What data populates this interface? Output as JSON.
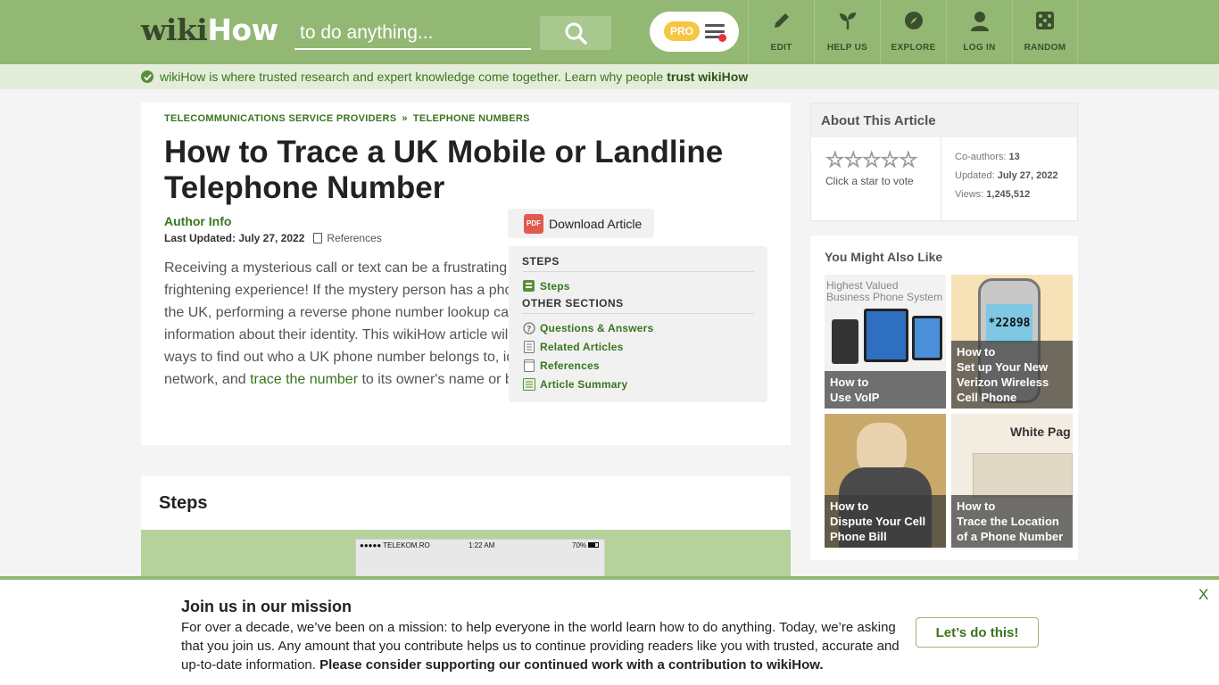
{
  "header": {
    "logo_wiki": "wiki",
    "logo_how": "How",
    "search_placeholder": "to do anything...",
    "pro_label": "PRO",
    "nav": [
      {
        "label": "EDIT",
        "icon": "pencil-icon"
      },
      {
        "label": "HELP US",
        "icon": "sprout-icon"
      },
      {
        "label": "EXPLORE",
        "icon": "compass-icon"
      },
      {
        "label": "LOG IN",
        "icon": "user-icon"
      },
      {
        "label": "RANDOM",
        "icon": "dice-icon"
      }
    ]
  },
  "trust": {
    "text": "wikiHow is where trusted research and expert knowledge come together. Learn why people",
    "link": "trust wikiHow"
  },
  "article": {
    "crumb1": "TELECOMMUNICATIONS SERVICE PROVIDERS",
    "crumb_sep": "»",
    "crumb2": "TELEPHONE NUMBERS",
    "title": "How to Trace a UK Mobile or Landline Telephone Number",
    "author_info": "Author Info",
    "last_updated": "Last Updated: July 27, 2022",
    "references": "References",
    "intro_before": "Receiving a mysterious call or text can be a frustrating or even frightening experience! If the mystery person has a phone number from the UK, performing a reverse phone number lookup can give you lots of information about their identity. This wikiHow article will show you simple ways to find out who a UK phone number belongs to, identify its mobile network, and ",
    "intro_link": "trace the number",
    "intro_after": " to its owner's name or business.",
    "download_label": "Download Article",
    "pdf_label": "PDF",
    "toc": {
      "steps_head": "STEPS",
      "steps_item": "Steps",
      "other_head": "OTHER SECTIONS",
      "items": [
        "Questions & Answers",
        "Related Articles",
        "References",
        "Article Summary"
      ]
    }
  },
  "steps": {
    "title": "Steps",
    "phone_carrier": "●●●●● TELEKOM.RO",
    "phone_time": "1:22 AM",
    "phone_battery": "70%"
  },
  "about": {
    "title": "About This Article",
    "vote": "Click a star to vote",
    "coauthors_label": "Co-authors:",
    "coauthors": "13",
    "updated_label": "Updated:",
    "updated": "July 27, 2022",
    "views_label": "Views:",
    "views": "1,245,512"
  },
  "also": {
    "title": "You Might Also Like",
    "tiles": [
      {
        "line1": "How to",
        "line2": "Use VoIP",
        "image_text": "Highest Valued Business Phone System"
      },
      {
        "line1": "How to",
        "line2": "Set up Your New Verizon Wireless Cell Phone",
        "image_text": "*22898"
      },
      {
        "line1": "How to",
        "line2": "Dispute Your Cell Phone Bill",
        "image_text": ""
      },
      {
        "line1": "How to",
        "line2": "Trace the Location of a Phone Number",
        "image_text": "White Pag"
      }
    ]
  },
  "mission": {
    "title": "Join us in our mission",
    "body": "For over a decade, we’ve been on a mission: to help everyone in the world learn how to do anything. Today, we’re asking that you join us. Any amount that you contribute helps us to continue providing readers like you with trusted, accurate and up-to-date information. ",
    "body_bold": "Please consider supporting our continued work with a contribution to wikiHow.",
    "button": "Let’s do this!",
    "close": "X"
  },
  "colors": {
    "brand_green": "#93b874",
    "link_green": "#38761d",
    "trust_bg": "#e3edd9"
  }
}
